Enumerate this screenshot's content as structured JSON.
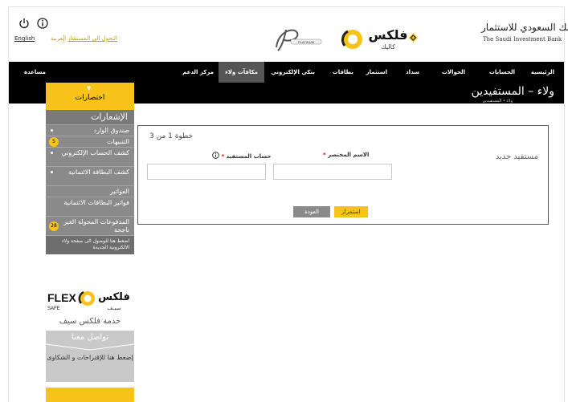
{
  "header": {
    "lang_en": "English",
    "lang_ar": "العربية",
    "switch_link": "التحول الى المستشار"
  },
  "logos": {
    "platinum": "PLATINUM",
    "flex_ar": "فلكس",
    "flex_sub": "كاليك",
    "bank_ar": "البنك السعودي للاستثمار",
    "bank_en": "The Saudi Investment Bank"
  },
  "nav": {
    "items": [
      "الرئيسية",
      "الحسابات",
      "الحوالات",
      "سداد",
      "استثمار",
      "بطاقات",
      "بنكي الإلكتروني",
      "مكافآت ولاء",
      "مركز الدعم",
      "مساعدة"
    ],
    "active_index": 7
  },
  "dropdown": {
    "label": "اختصارات"
  },
  "title": {
    "main": "ولاء – المستفيدين",
    "crumb": "ولاء • المستفيدين"
  },
  "sidebar": {
    "heading": "الإشعارات",
    "items": [
      {
        "label": "صندوق الوارد",
        "badge": "",
        "marker": "dot"
      },
      {
        "label": "التنبيهات",
        "badge": "5",
        "marker": "badge"
      },
      {
        "label": "كشف الحساب الإلكتروني",
        "badge": "",
        "marker": "dot"
      },
      {
        "label": "كشف البطاقة الائتمانية",
        "badge": "",
        "marker": "dot"
      },
      {
        "label": "الفواتير",
        "badge": "",
        "marker": "none"
      },
      {
        "label": "فواتير البطاقات الائتمانية",
        "badge": "",
        "marker": "none"
      },
      {
        "label": "المدفوعات المحولة الغير ناجحة",
        "badge": "28",
        "marker": "badge"
      }
    ],
    "link": "اضغط هنا للوصول الى صفحة ولاء الالكترونية الجديدة"
  },
  "flexsafe": {
    "brand_en": "FLEX",
    "brand_en_sub": "SAFE",
    "brand_ar": "فلكس",
    "brand_ar_sub": "سيـف",
    "caption": "خدمة فلكس سيف"
  },
  "contact": {
    "title": "تواصل معنا",
    "text": "إضغط هنا للإقتراحات و الشكاوى"
  },
  "form": {
    "step": "خطوة 1 من 3",
    "heading": "مستفيد جديد",
    "nickname_label": "الاسم المختصر",
    "account_label": "حساب المستفيد",
    "required_mark": "*",
    "nickname_value": "",
    "account_value": "",
    "back_button": "العودة",
    "continue_button": "استمرار"
  },
  "colors": {
    "accent": "#f7c21a",
    "nav_bg": "#000000",
    "sidebar_bg": "#8a8a8a"
  }
}
